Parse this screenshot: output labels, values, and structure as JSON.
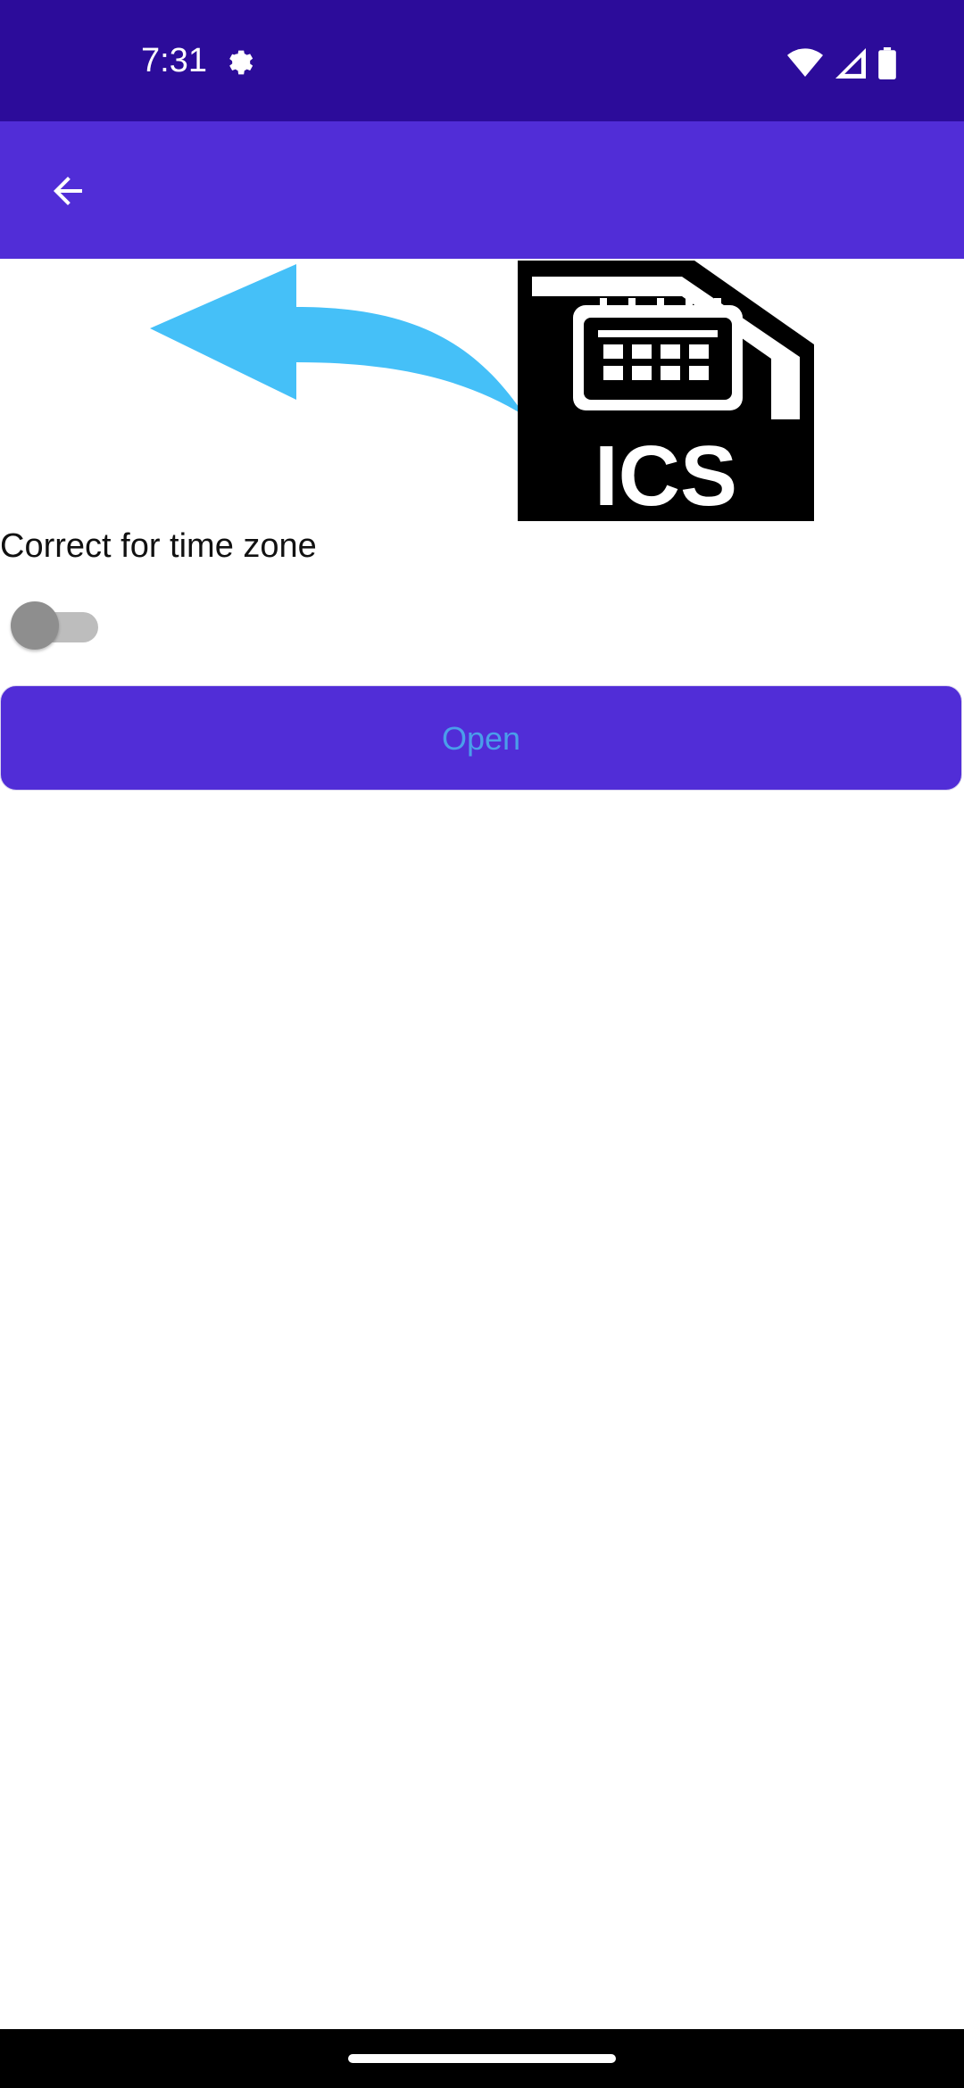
{
  "status_bar": {
    "time": "7:31",
    "icons": [
      "settings-gear-icon",
      "wifi-icon",
      "signal-icon",
      "battery-icon"
    ]
  },
  "app_bar": {
    "back_icon": "arrow-back-icon",
    "background": "#512dd7"
  },
  "hero": {
    "arrow_color": "#45c0f8",
    "file_label": "ICS"
  },
  "settings": {
    "timezone_label": "Correct for time zone",
    "timezone_enabled": false
  },
  "actions": {
    "open_label": "Open"
  },
  "colors": {
    "status_bar": "#2c0c9a",
    "primary": "#512dd7",
    "button_text": "#4a9eea"
  }
}
